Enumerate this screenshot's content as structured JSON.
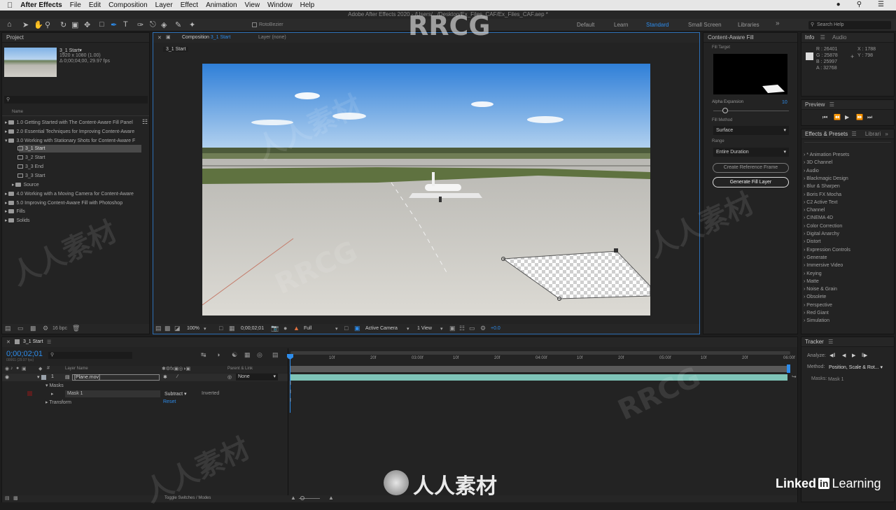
{
  "menubar": {
    "apple": "",
    "app_name": "After Effects",
    "items": [
      "File",
      "Edit",
      "Composition",
      "Layer",
      "Effect",
      "Animation",
      "View",
      "Window",
      "Help"
    ]
  },
  "window_title": "Adobe After Effects 2020 - /Users/.../Desktop/Ex_Files_CAF/Ex_Files_CAF.aep *",
  "toolbar": {
    "rotobezier": "RotoBezier",
    "workspaces": [
      "Default",
      "Learn",
      "Standard",
      "Small Screen",
      "Libraries"
    ],
    "active_workspace": "Standard",
    "search_help": "Search Help"
  },
  "project": {
    "title": "Project",
    "thumb_name": "3_1 Start▾",
    "thumb_size": "1920 x 1080 (1.00)",
    "thumb_duration": "Δ 0;00;04;00, 29.97 fps",
    "col_name": "Name",
    "items": [
      {
        "label": "1.0 Getting Started with The Content-Aware Fill Panel",
        "type": "folder"
      },
      {
        "label": "2.0 Essential Techniques for Improving Content-Aware",
        "type": "folder"
      },
      {
        "label": "3.0 Working with Stationary Shots for Content-Aware F",
        "type": "folder"
      },
      {
        "label": "3_1 Start",
        "type": "comp",
        "selected": true
      },
      {
        "label": "3_2 Start",
        "type": "comp"
      },
      {
        "label": "3_3 End",
        "type": "comp"
      },
      {
        "label": "3_3 Start",
        "type": "comp"
      },
      {
        "label": "Source",
        "type": "folder"
      },
      {
        "label": "4.0 Working with a Moving Camera for Content-Aware",
        "type": "folder"
      },
      {
        "label": "5.0 Improving Content-Aware Fill with Photoshop",
        "type": "folder"
      },
      {
        "label": "Fills",
        "type": "folder"
      },
      {
        "label": "Solids",
        "type": "folder"
      }
    ],
    "bpc": "16 bpc"
  },
  "composition": {
    "tab_label": "Composition",
    "tab_name": "3_1 Start",
    "layer_tab": "Layer (none)",
    "breadcrumb": "3_1 Start",
    "zoom": "100%",
    "timecode": "0;00;02;01",
    "resolution": "Full",
    "camera": "Active Camera",
    "views": "1 View",
    "exposure": "+0.0"
  },
  "caf": {
    "title": "Content-Aware Fill",
    "fill_target": "Fill Target",
    "alpha_label": "Alpha Expansion",
    "alpha_value": "10",
    "alpha_level": 0.05,
    "method_label": "Fill Method",
    "method_value": "Surface",
    "range_label": "Range",
    "range_value": "Entire Duration",
    "ref_button": "Create Reference Frame",
    "gen_button": "Generate Fill Layer"
  },
  "info": {
    "tab1": "Info",
    "tab2": "Audio",
    "r": "R : 26401",
    "g": "G : 25878",
    "b": "B : 25997",
    "a": "A : 32768",
    "x": "X : 1788",
    "y": "Y : 798"
  },
  "preview": {
    "title": "Preview"
  },
  "effects": {
    "title": "Effects & Presets",
    "tab2": "Librari",
    "items": [
      "* Animation Presets",
      "3D Channel",
      "Audio",
      "Blackmagic Design",
      "Blur & Sharpen",
      "Boris FX Mocha",
      "C2 Active Text",
      "Channel",
      "CINEMA 4D",
      "Color Correction",
      "Digital Anarchy",
      "Distort",
      "Expression Controls",
      "Generate",
      "Immersive Video",
      "Keying",
      "Matte",
      "Noise & Grain",
      "Obsolete",
      "Perspective",
      "Red Giant",
      "Simulation"
    ]
  },
  "timeline": {
    "tab": "3_1 Start",
    "timecode": "0;00;02;01",
    "fps_sub": "00061 (29.97 fps)",
    "col_layer_name": "Layer Name",
    "col_parent": "Parent & Link",
    "layer_num": "1",
    "layer_name": "[Plane.mov]",
    "parent_value": "None",
    "masks": "Masks",
    "mask1": "Mask 1",
    "mask_mode": "Subtract",
    "inverted": "Inverted",
    "transform": "Transform",
    "reset": "Reset",
    "toggle": "Toggle Switches / Modes",
    "ruler": [
      "0f",
      "10f",
      "20f",
      "03:00f",
      "10f",
      "20f",
      "04:00f",
      "10f",
      "20f",
      "05:00f",
      "10f",
      "20f",
      "06:00f"
    ],
    "playhead_time": "0;00;02;01"
  },
  "tracker": {
    "title": "Tracker",
    "analyze": "Analyze:",
    "method_label": "Method:",
    "method_value": "Position, Scale & Rot...",
    "masks_label": "Masks:",
    "masks_value": "Mask 1"
  },
  "watermarks": {
    "rrcg": "RRCG",
    "cn": "人人素材",
    "linkedin_a": "Linked",
    "linkedin_in": "in",
    "linkedin_b": "Learning"
  },
  "colors": {
    "accent": "#2d8ceb",
    "panel_bg": "#232323",
    "timeline_bar": "#7fc4b8"
  }
}
